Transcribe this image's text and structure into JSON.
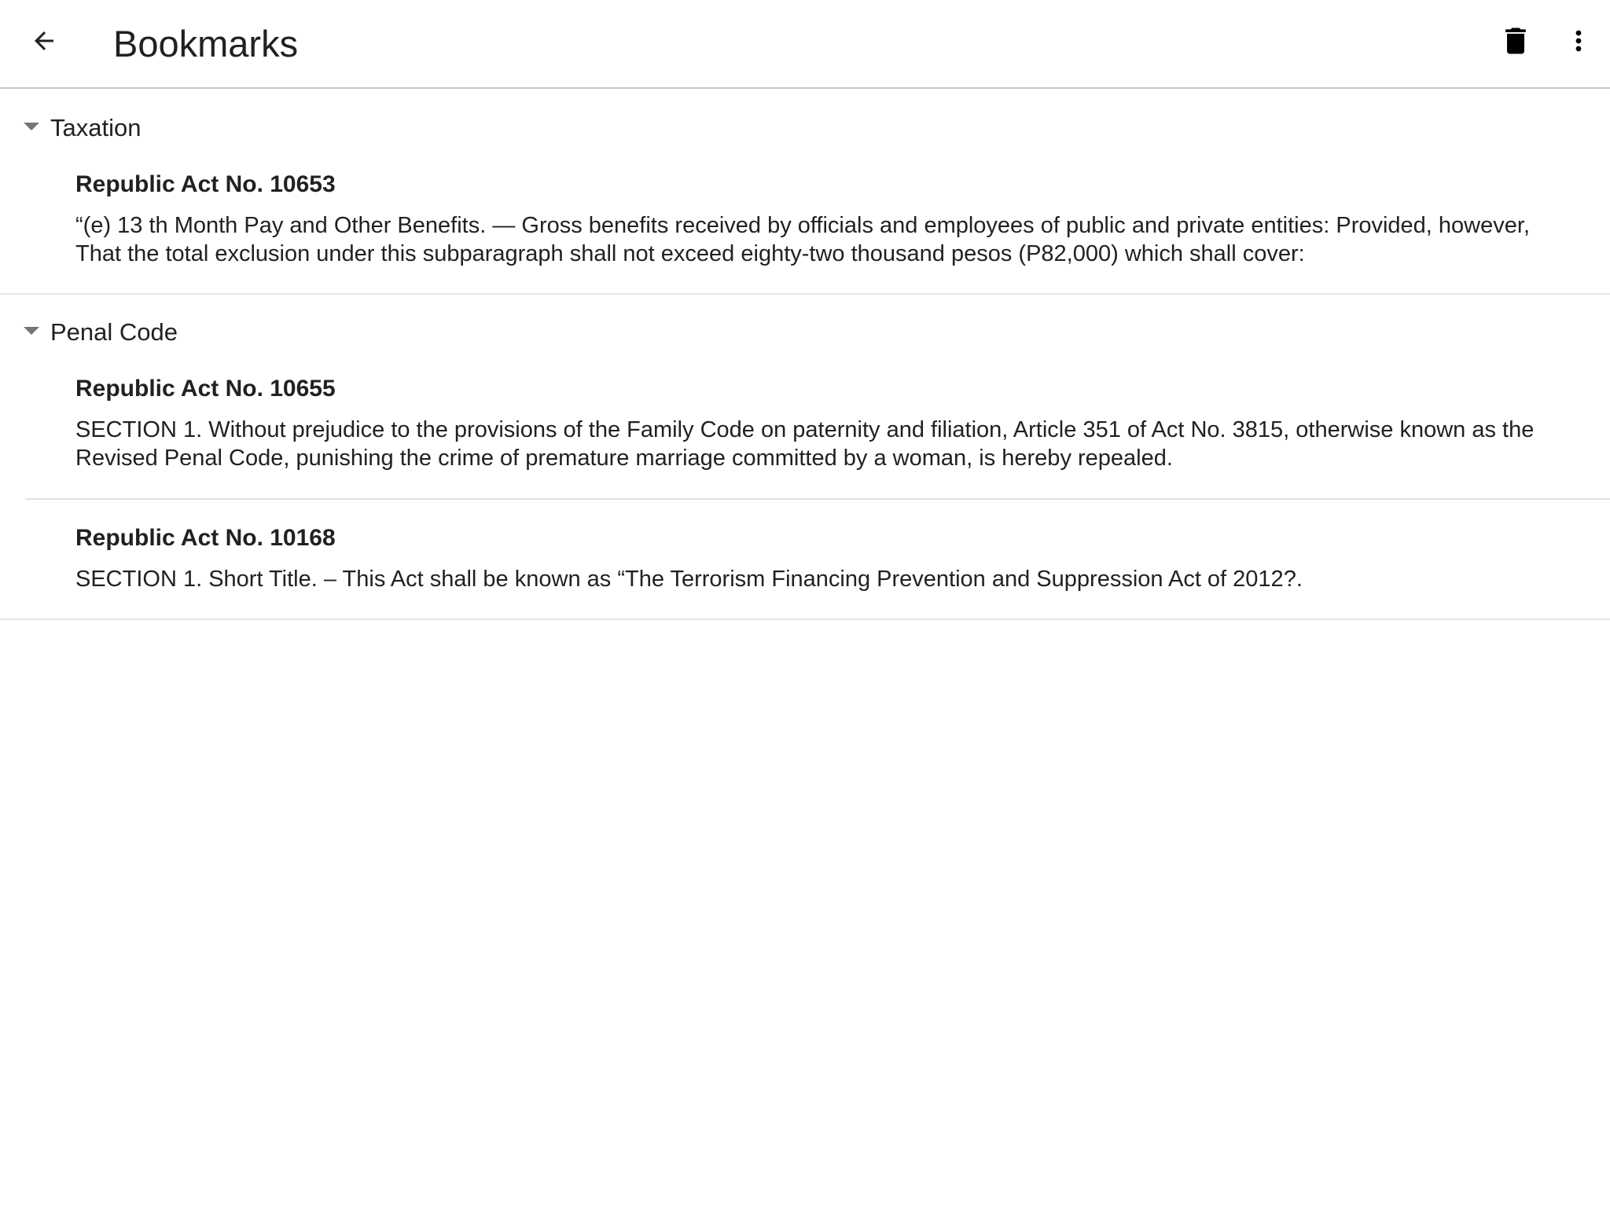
{
  "appbar": {
    "title": "Bookmarks",
    "back_icon": "arrow-left-icon",
    "delete_icon": "trash-icon",
    "more_icon": "more-vertical-icon"
  },
  "groups": [
    {
      "label": "Taxation",
      "expanded": true,
      "items": [
        {
          "title": "Republic Act No. 10653",
          "text": "“(e) 13 th Month Pay and Other Benefits. — Gross benefits received by officials and employees of public and private entities: Provided, however, That the total exclusion under this subparagraph shall not exceed eighty-two thousand pesos (P82,000) which shall cover:"
        }
      ]
    },
    {
      "label": "Penal Code",
      "expanded": true,
      "items": [
        {
          "title": "Republic Act No. 10655",
          "text": "SECTION 1. Without prejudice to the provisions of the Family Code on paternity and filiation, Article 351 of Act No. 3815, otherwise known as the Revised Penal Code, punishing the crime of premature marriage committed by a woman, is hereby repealed."
        },
        {
          "title": "Republic Act No. 10168",
          "text": "SECTION 1. Short Title. – This Act shall be known as “The Terrorism Financing Prevention and Suppression Act of 2012?."
        }
      ]
    }
  ]
}
